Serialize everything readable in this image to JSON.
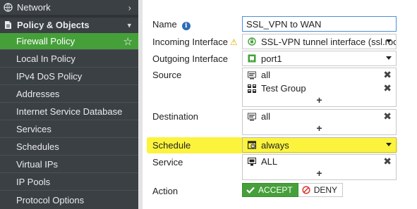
{
  "sidebar": {
    "top_items": [
      {
        "label": "Network",
        "icon": "network-icon"
      },
      {
        "label": "Policy & Objects",
        "icon": "policy-objects-icon"
      }
    ],
    "items": [
      {
        "label": "Firewall Policy",
        "active": true
      },
      {
        "label": "Local In Policy"
      },
      {
        "label": "IPv4 DoS Policy"
      },
      {
        "label": "Addresses"
      },
      {
        "label": "Internet Service Database"
      },
      {
        "label": "Services"
      },
      {
        "label": "Schedules"
      },
      {
        "label": "Virtual IPs"
      },
      {
        "label": "IP Pools"
      },
      {
        "label": "Protocol Options"
      }
    ],
    "colors": {
      "background": "#3b4044",
      "active": "#46a03a"
    }
  },
  "form": {
    "name": {
      "label": "Name",
      "value": "SSL_VPN to WAN"
    },
    "incoming": {
      "label": "Incoming Interface",
      "value": "SSL-VPN tunnel interface (ssl.roo"
    },
    "outgoing": {
      "label": "Outgoing Interface",
      "value": "port1"
    },
    "source": {
      "label": "Source",
      "entries": [
        "all",
        "Test Group"
      ],
      "add": "+"
    },
    "destination": {
      "label": "Destination",
      "entries": [
        "all"
      ],
      "add": "+"
    },
    "schedule": {
      "label": "Schedule",
      "value": "always"
    },
    "service": {
      "label": "Service",
      "entries": [
        "ALL"
      ],
      "add": "+"
    },
    "action": {
      "label": "Action",
      "accept": "ACCEPT",
      "deny": "DENY"
    }
  },
  "colors": {
    "accept": "#46a03a",
    "highlight": "#fbf11a",
    "info": "#2f6cb4",
    "warning": "#e6a500",
    "deny": "#d9413a"
  }
}
